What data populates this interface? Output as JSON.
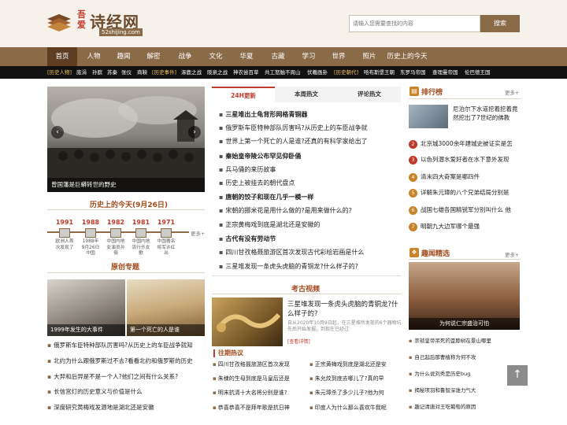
{
  "header": {
    "logo_main": "诗经网",
    "logo_side": "吾爱",
    "logo_url": "52shijing.com",
    "search_placeholder": "请输入您需要查找的内容",
    "search_button": "搜索"
  },
  "nav": [
    "首页",
    "人物",
    "趣闻",
    "解密",
    "战争",
    "文化",
    "华夏",
    "古藏",
    "学习",
    "世界",
    "照片",
    "历史上的今天"
  ],
  "subnav": [
    {
      "text": "[历史人物]",
      "tag": true
    },
    {
      "text": "庞涓"
    },
    {
      "text": "孙膑"
    },
    {
      "text": "苏秦"
    },
    {
      "text": "张仪"
    },
    {
      "text": "商鞅"
    },
    {
      "text": "[历史事件]",
      "tag": true
    },
    {
      "text": "涿鹿之战"
    },
    {
      "text": "阪泉之战"
    },
    {
      "text": "神农尝百草"
    },
    {
      "text": "共工怒触不周山"
    },
    {
      "text": "伏羲画卦"
    },
    {
      "text": "[历史朝代]",
      "tag": true
    },
    {
      "text": "哈布斯堡王朝"
    },
    {
      "text": "东罗马帝国"
    },
    {
      "text": "查理曼帝国"
    },
    {
      "text": "伦巴德王国"
    }
  ],
  "banner": {
    "caption": "曾国藩是巨蟒转世的野史"
  },
  "today": {
    "title": "历史上的今天(9月26日)",
    "more": "更多+",
    "items": [
      {
        "year": "1991",
        "text": "欧洲人首次发现了"
      },
      {
        "year": "1988",
        "text": "1988年9月26日中国"
      },
      {
        "year": "1982",
        "text": "中国内地女演员孙俪"
      },
      {
        "year": "1981",
        "text": "中国内地流行乐女歌"
      },
      {
        "year": "1971",
        "text": "中国著名将军许红出"
      }
    ]
  },
  "topics": {
    "title": "原创专题",
    "pics": [
      {
        "caption": "1999年发生的大事件"
      },
      {
        "caption": "第一个死亡的人是谁"
      }
    ],
    "list": [
      "俄罗斯车臣特种部队厉害吗?从历史上的车臣战争就知",
      "北约为什么跟俄罗斯过不去?看看北约和俄罗斯的历史",
      "大羿和后羿是不是一个人?他们之间有什么关系?",
      "长信宫灯的历史意义与价值是什么",
      "深度研究黄梅戏发源地是湖北还是安徽"
    ]
  },
  "tabs": [
    "24H更新",
    "本周热文",
    "评论热文"
  ],
  "news": [
    {
      "text": "三星堆出土龟背形网格青铜器",
      "bold": true
    },
    {
      "text": "俄罗斯车臣特种部队厉害吗?从历史上的车臣战争就",
      "bold": false
    },
    {
      "text": "世界上第一个死亡的人是谁?还真的有科学家给出了",
      "bold": false
    },
    {
      "text": "秦始皇帝陵公布罕见仰卧俑",
      "bold": true
    },
    {
      "text": "兵马俑的来历故事",
      "bold": false
    },
    {
      "text": "历史上被挂去的朝代盘点",
      "bold": false
    },
    {
      "text": "唐朝的饺子和现在几乎一模一样",
      "bold": true
    },
    {
      "text": "宋朝的挪米花是用什么做的?是用来做什么的?",
      "bold": false
    },
    {
      "text": "正宗黄梅戏到底是湖北还是安徽的",
      "bold": false
    },
    {
      "text": "古代有没有劳动节",
      "bold": true
    },
    {
      "text": "四川甘孜格聂旅游区首次发现古代彩绘岩画是什么",
      "bold": false
    },
    {
      "text": "三星堆发现一条虎头虎脑的青铜龙?什么样子的?",
      "bold": false
    }
  ],
  "hot": {
    "title": "考古视频",
    "feature_title": "三星堆发现一条虎头虎脑的青铜龙?什么样子的?",
    "feature_desc": "自从2020年10月9日起，在三星堆所发现的6个器物坑先后开始发掘，到现在已经过",
    "feature_more": "[查看详情]"
  },
  "past": {
    "title": "往期热议",
    "left": [
      "四川甘孜格聂旅游区首次发现",
      "朱棣的生母到底是马皇后还是",
      "明末抗清十大名将分别是谁?",
      "恭喜恭喜不是拜年歌是抗日神"
    ],
    "right": [
      "正宗黄梅戏到底是湖北还是安",
      "朱允炆到底去哪儿了?真的早",
      "朱元璋杀了多少儿子?他为何",
      "印度人为什么那么喜欢牛我呢"
    ]
  },
  "rank": {
    "title": "排行榜",
    "more": "更多+",
    "top": "尼泊尔下水道挖着挖着竟然挖出了7世纪的佛教",
    "items": [
      "北京城3000余年建城史被证实是怎",
      "以色列潜水爱好者在水下意外发现",
      "清末四大奇案是哪四件",
      "详解朱元璋的八个兄弟结局分别是",
      "战国七雄各国精锐军分别叫什么 他",
      "明朝九大边军哪个最强"
    ]
  },
  "fun": {
    "title": "趣闻精选",
    "more": "更多+",
    "pic_caption": "为何说仁宗盛治可怕",
    "list": [
      "崇祯皇帝吊死的歪脖树在景山哪里",
      "自己起后那曹植称为何不攻",
      "为什么说刘秀是历史bug",
      "揭秘项羽和鲁智深谁力气大",
      "趣记清唐对王吃葡萄的原因"
    ]
  },
  "totop": "↑"
}
